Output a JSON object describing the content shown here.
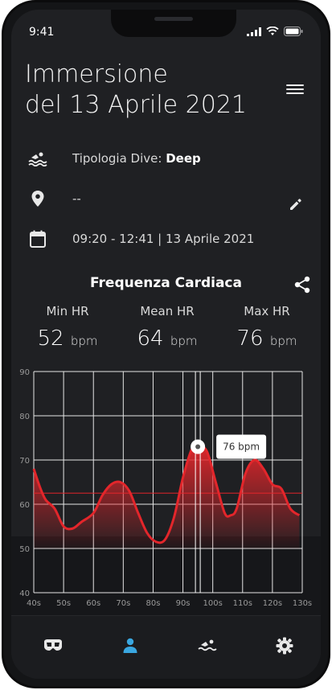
{
  "status_bar": {
    "time": "9:41"
  },
  "header": {
    "title_line1": "Immersione",
    "title_line2": "del 13 Aprile 2021"
  },
  "info": {
    "dive_type_label": "Tipologia Dive:",
    "dive_type_value": "Deep",
    "location": "--",
    "datetime": "09:20 - 12:41 | 13 Aprile 2021"
  },
  "heart_rate": {
    "title": "Frequenza Cardiaca",
    "min_label": "Min HR",
    "min_value": "52",
    "min_unit": "bpm",
    "mean_label": "Mean HR",
    "mean_value": "64",
    "mean_unit": "bpm",
    "max_label": "Max HR",
    "max_value": "76",
    "max_unit": "bpm",
    "tooltip": "76 bpm"
  },
  "chart_data": {
    "type": "area",
    "xlabel": "",
    "ylabel": "",
    "x_ticks": [
      "40s",
      "50s",
      "60s",
      "70s",
      "80s",
      "90s",
      "100s",
      "110s",
      "120s",
      "130s"
    ],
    "y_ticks": [
      40,
      50,
      60,
      70,
      80,
      90
    ],
    "ylim": [
      40,
      90
    ],
    "xlim": [
      40,
      130
    ],
    "grid": true,
    "mean_line": 62.5,
    "selected_point": {
      "x": 95,
      "y": 73
    },
    "x": [
      40,
      42,
      44,
      47,
      50,
      53,
      56,
      60,
      63,
      66,
      69,
      72,
      75,
      78,
      81,
      84,
      87,
      90,
      93,
      95,
      98,
      101,
      104,
      106,
      108,
      111,
      114,
      117,
      120,
      123,
      126,
      129
    ],
    "values": [
      68,
      64,
      61,
      59,
      55,
      54.5,
      56,
      58,
      62,
      64.5,
      65,
      63,
      58,
      53.5,
      51.5,
      52,
      57,
      66,
      72.5,
      73,
      72,
      65,
      58,
      57.5,
      59,
      67,
      70,
      68,
      64.5,
      63.5,
      59,
      57.5
    ]
  },
  "nav": {
    "items": [
      "mask",
      "profile",
      "swim",
      "settings"
    ],
    "active": "profile"
  },
  "colors": {
    "accent": "#e3262b",
    "active_nav": "#3aa7e0"
  }
}
